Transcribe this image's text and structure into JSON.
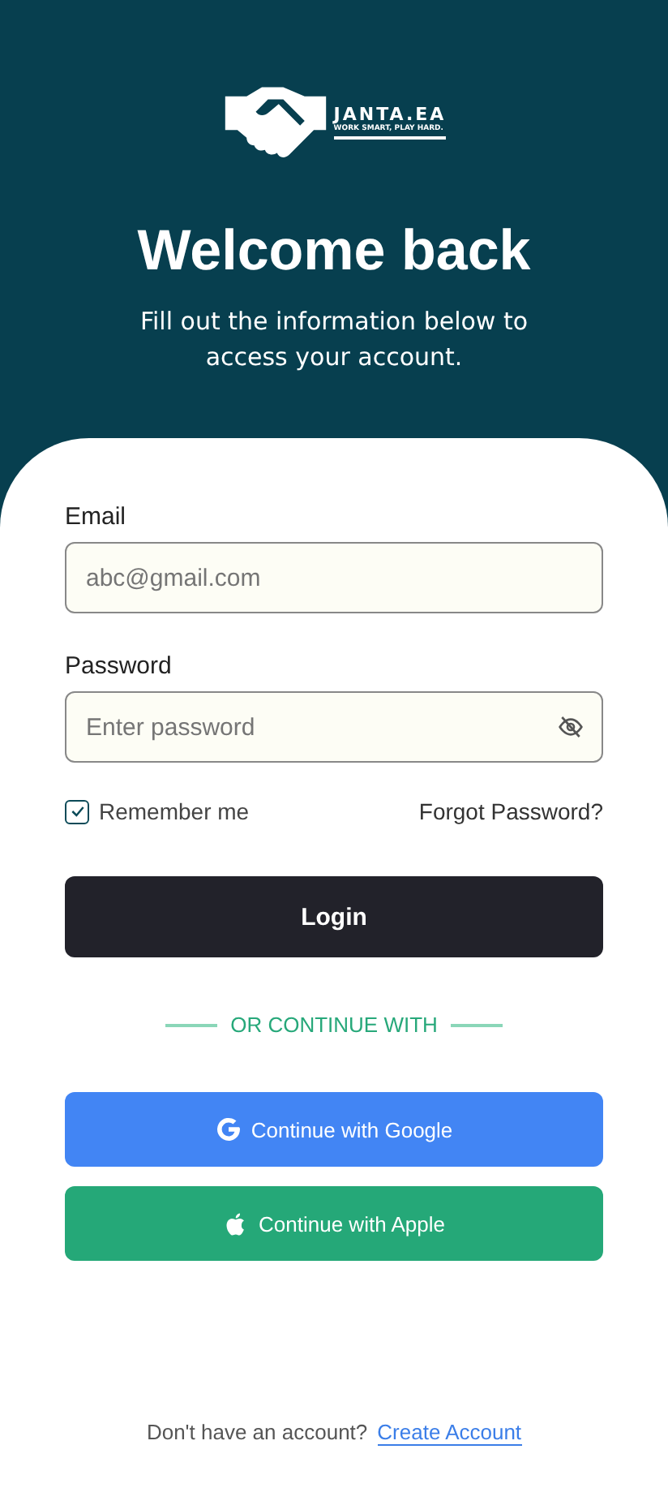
{
  "logo": {
    "name": "JANTA.EA",
    "tagline": "WORK SMART, PLAY HARD."
  },
  "title": "Welcome back",
  "subtitle": "Fill out the information below to access your account.",
  "email": {
    "label": "Email",
    "placeholder": "abc@gmail.com"
  },
  "password": {
    "label": "Password",
    "placeholder": "Enter password",
    "visible": false
  },
  "remember": {
    "label": "Remember me",
    "checked": true
  },
  "forgot": "Forgot Password?",
  "login": "Login",
  "divider": "OR CONTINUE WITH",
  "social": [
    {
      "kind": "google",
      "label": "Continue with Google"
    },
    {
      "kind": "apple",
      "label": "Continue with Apple"
    }
  ],
  "footer": {
    "text": "Don't have an account?",
    "link": "Create Account"
  }
}
